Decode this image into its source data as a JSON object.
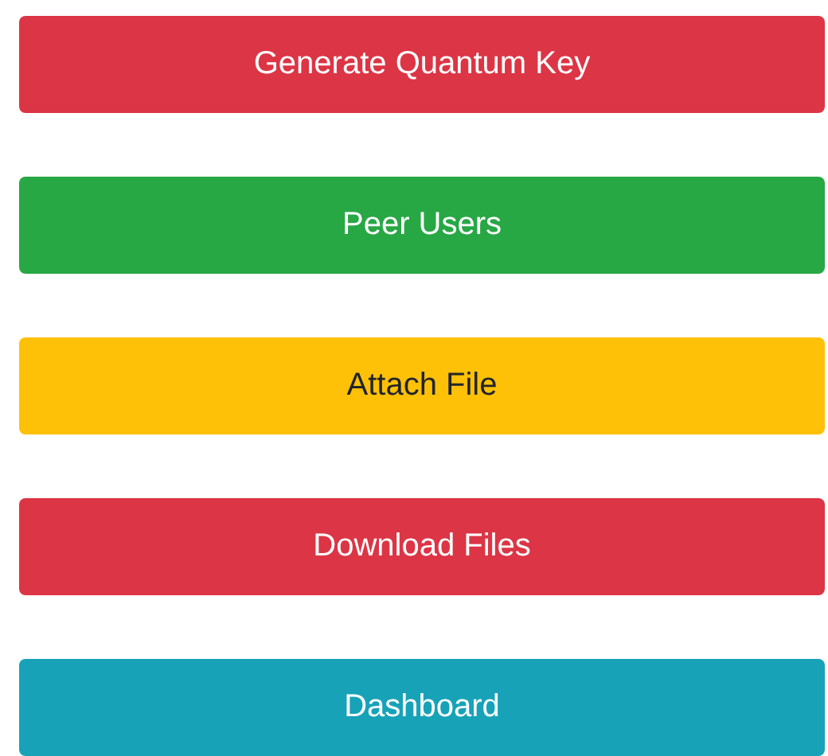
{
  "buttons": [
    {
      "label": "Generate Quantum Key",
      "color": "#dc3545"
    },
    {
      "label": "Peer Users",
      "color": "#28a745"
    },
    {
      "label": "Attach File",
      "color": "#ffc107"
    },
    {
      "label": "Download Files",
      "color": "#dc3545"
    },
    {
      "label": "Dashboard",
      "color": "#17a2b8"
    }
  ]
}
